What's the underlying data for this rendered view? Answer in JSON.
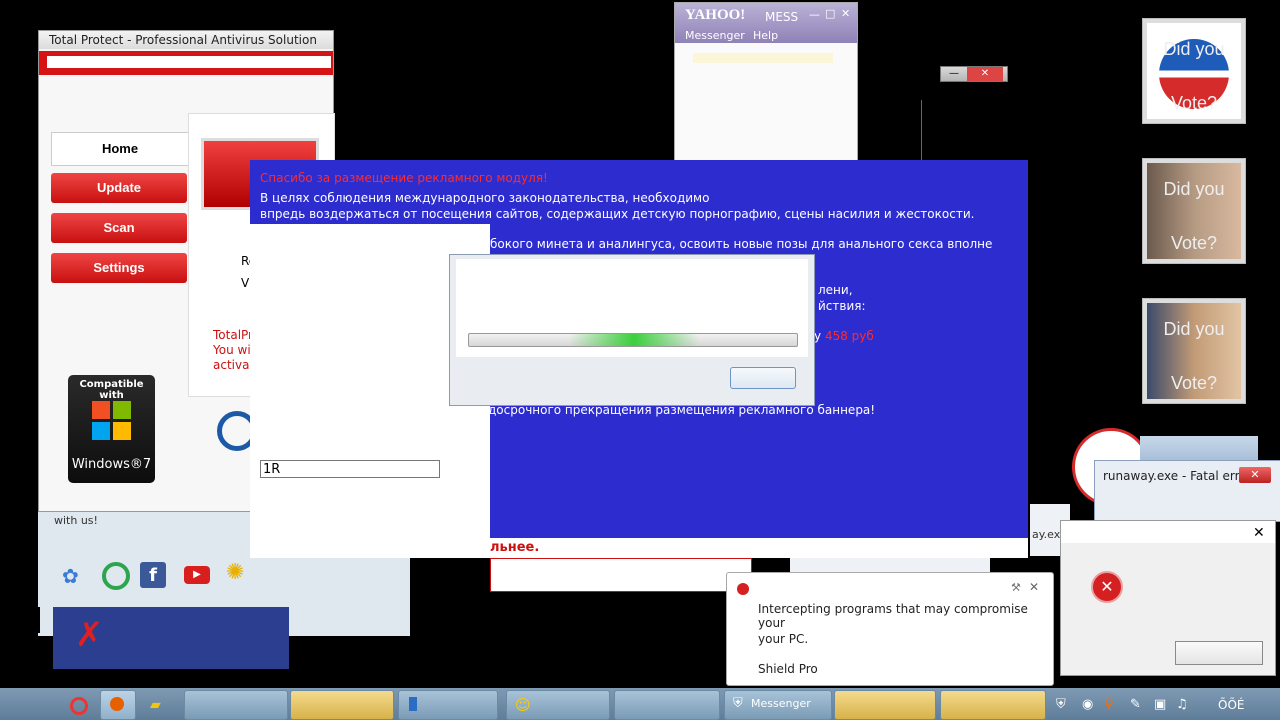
{
  "antivirus": {
    "title": "Total Protect - Professional Antivirus Solution",
    "nav": [
      "Home",
      "Update",
      "Scan",
      "Settings"
    ],
    "partial_lines": [
      "Re",
      "Vi"
    ],
    "red_lines": [
      "TotalPr",
      "You wil",
      "activati"
    ],
    "compat_label": "Compatible with",
    "windows_label": "Windows®7",
    "footer_text": "with us!"
  },
  "yahoo": {
    "logo": "YAHOO!",
    "title": "MESS",
    "menu": [
      "Messenger",
      "Help"
    ]
  },
  "ransom": {
    "red_heading": "Спасибо за размещение рекламного модуля!",
    "line1": "В целях соблюдения международного законодательства, необходимо",
    "line2": "впредь воздержаться от посещения сайтов, содержащих детскую порнографию, сцены насилия и жестокости.",
    "line3": "бокого минета и аналингуса, освоить новые позы для анального секса вполне естественно.",
    "line4": "лени,",
    "line5": "йствия:",
    "price_prefix": "у",
    "price": "458 руб",
    "line6": "досрочного прекращения размещения рекламного баннера!",
    "input_value": "1R",
    "bottom_text": "льнее."
  },
  "posters": [
    {
      "line1": "Did you",
      "line2": "Vote?"
    },
    {
      "line1": "Did you",
      "line2": "Vote?"
    },
    {
      "line1": "Did you",
      "line2": "Vote?"
    }
  ],
  "fatal": {
    "title": "runaway.exe - Fatal error",
    "close_glyph": "✕"
  },
  "error_dialog": {
    "close_glyph": "✕"
  },
  "shield": {
    "line1": "Intercepting programs that may compromise your",
    "line2": "your PC.",
    "line3": "Shield Pro",
    "close_glyph": "✕"
  },
  "background_window": {
    "fragment": "ay.ex"
  },
  "taskbar": {
    "messenger_label": "Messenger",
    "clock": "ÕÕÉ"
  },
  "colors": {
    "ransom_blue": "#2c2ccf",
    "alert_red": "#cc1111",
    "progress_green": "#3ccf3c"
  }
}
